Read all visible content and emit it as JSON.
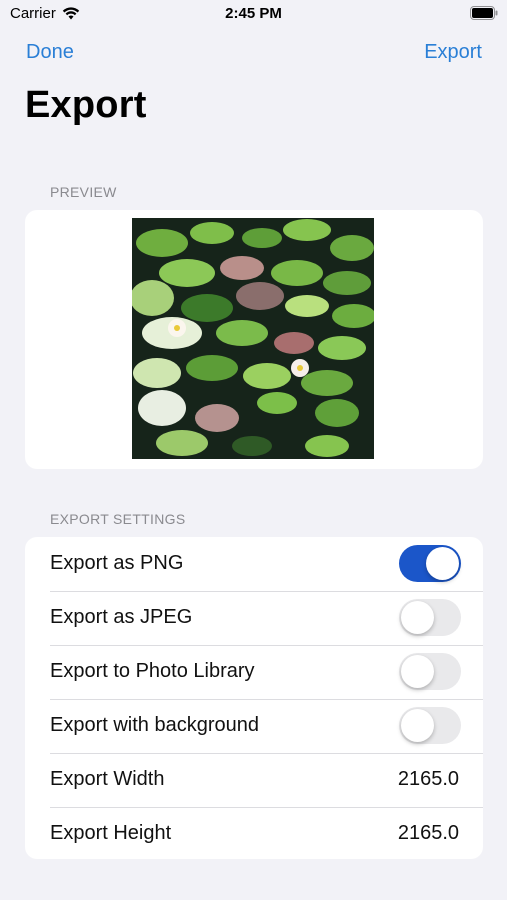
{
  "status_bar": {
    "carrier": "Carrier",
    "time": "2:45 PM"
  },
  "nav": {
    "done_label": "Done",
    "export_label": "Export"
  },
  "page": {
    "title": "Export"
  },
  "preview": {
    "header": "PREVIEW"
  },
  "settings": {
    "header": "EXPORT SETTINGS",
    "rows": [
      {
        "label": "Export as PNG",
        "toggle": true
      },
      {
        "label": "Export as JPEG",
        "toggle": false
      },
      {
        "label": "Export to Photo Library",
        "toggle": false
      },
      {
        "label": "Export with background",
        "toggle": false
      },
      {
        "label": "Export Width",
        "value": "2165.0"
      },
      {
        "label": "Export Height",
        "value": "2165.0"
      }
    ]
  },
  "colors": {
    "accent": "#2a7fd6",
    "toggle_on": "#1b56c9",
    "toggle_off": "#e9e9eb",
    "background": "#f2f2f7"
  }
}
